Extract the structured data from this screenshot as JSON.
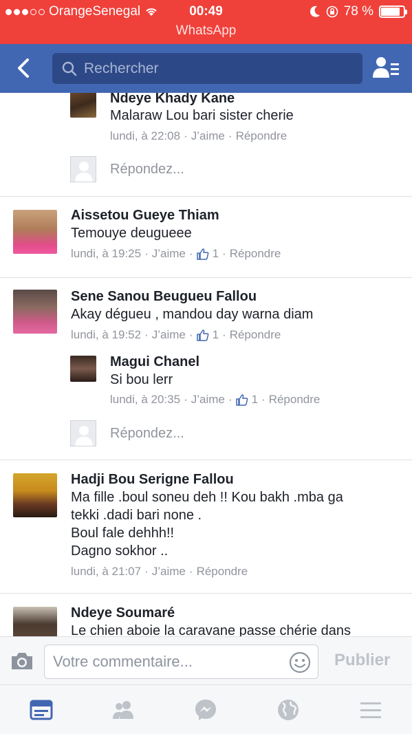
{
  "status_bar": {
    "carrier": "OrangeSenegal",
    "time": "00:49",
    "battery": "78 %",
    "app_return": "WhatsApp"
  },
  "nav": {
    "search_placeholder": "Rechercher"
  },
  "comments": [
    {
      "name": "Ndeye Khady Kane",
      "text": "Malaraw Lou bari sister cherie",
      "time": "lundi, à 22:08",
      "like": "J’aime",
      "reply": "Répondre"
    },
    {
      "name": "Aissetou Gueye Thiam",
      "text": "Temouye deugueee",
      "time": "lundi, à 19:25",
      "like": "J’aime",
      "likes": "1",
      "reply": "Répondre"
    },
    {
      "name": "Sene Sanou Beugueu Fallou",
      "text": "Akay dégueu , mandou day warna diam",
      "time": "lundi, à 19:52",
      "like": "J’aime",
      "likes": "1",
      "reply": "Répondre"
    },
    {
      "name": "Magui Chanel",
      "text": "Si bou lerr",
      "time": "lundi, à 20:35",
      "like": "J’aime",
      "likes": "1",
      "reply": "Répondre"
    },
    {
      "name": "Hadji Bou Serigne Fallou",
      "text_lines": [
        "Ma fille .boul soneu deh !! Kou bakh .mba ga",
        "tekki .dadi bari none .",
        "Boul fale dehhh!!",
        "Dagno sokhor .."
      ],
      "time": "lundi, à 21:07",
      "like": "J’aime",
      "reply": "Répondre"
    },
    {
      "name": "Ndeye Soumaré",
      "text": "Le chien aboie la caravane passe chérie dans"
    }
  ],
  "reply_prompt": "Répondez...",
  "composer": {
    "placeholder": "Votre commentaire...",
    "publish": "Publier"
  },
  "colors": {
    "status_bar": "#f0403a",
    "nav": "#4267b2",
    "search_field": "#2d4886",
    "meta_text": "#90949c",
    "like_icon": "#4267b2",
    "tab_active": "#4267b2",
    "tab_inactive": "#bec3c9"
  },
  "icons": {
    "back": "back-chevron-icon",
    "search": "search-icon",
    "friends": "friends-list-icon",
    "like": "thumbs-up-icon",
    "camera": "camera-icon",
    "emoji": "smiley-icon",
    "tabs": [
      "news-feed-icon",
      "friends-icon",
      "messenger-icon",
      "globe-icon",
      "menu-icon"
    ]
  }
}
